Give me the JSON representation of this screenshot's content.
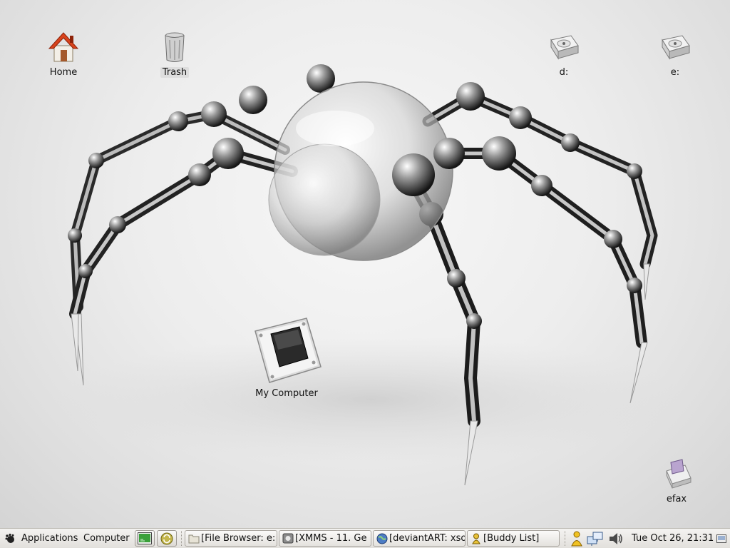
{
  "desktop": {
    "icons": {
      "home": {
        "label": "Home",
        "icon": "home-icon"
      },
      "trash": {
        "label": "Trash",
        "icon": "trash-icon"
      },
      "drive_d": {
        "label": "d:",
        "icon": "hard-drive-icon"
      },
      "drive_e": {
        "label": "e:",
        "icon": "hard-drive-icon"
      },
      "my_computer": {
        "label": "My Computer",
        "icon": "computer-icon"
      },
      "efax": {
        "label": "efax",
        "icon": "fax-icon"
      }
    },
    "wallpaper": "chrome-robot-spider"
  },
  "panel": {
    "menu_applications": "Applications",
    "menu_computer": "Computer",
    "tasks": [
      {
        "label": "[File Browser: e:",
        "icon": "folder-icon"
      },
      {
        "label": "[XMMS - 11. Ge",
        "icon": "xmms-icon"
      },
      {
        "label": "[deviantART: xso",
        "icon": "globe-icon"
      },
      {
        "label": "[Buddy List]",
        "icon": "buddy-icon"
      }
    ],
    "clock": "Tue Oct 26, 21:31"
  },
  "colors": {
    "panel_bg": "#e8e6e2",
    "home_roof": "#d8431c",
    "terminal_green": "#3aa03a"
  }
}
